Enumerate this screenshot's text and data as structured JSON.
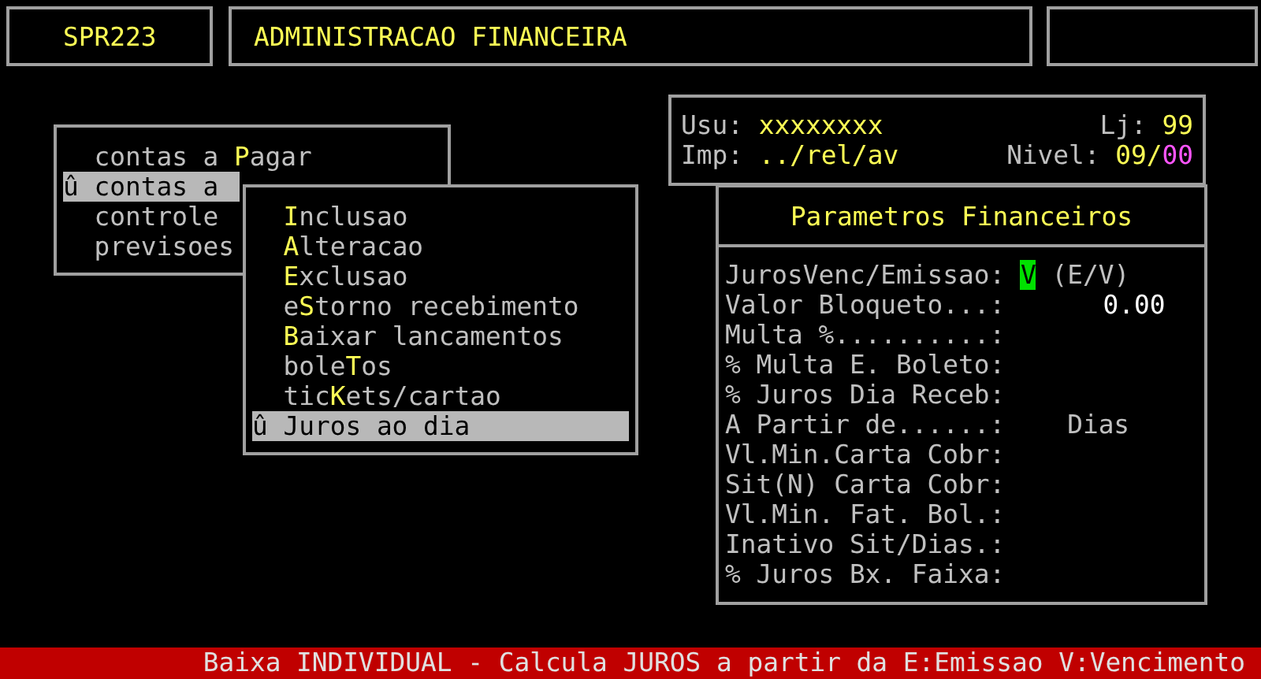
{
  "header": {
    "program_code": "SPR223",
    "title": "ADMINISTRACAO FINANCEIRA"
  },
  "main_menu": {
    "items": [
      {
        "label": "contas a ",
        "key": "P",
        "rest": "agar",
        "selected": false
      },
      {
        "marker": "û",
        "label": "contas a",
        "selected": true
      },
      {
        "label": "controle",
        "selected": false
      },
      {
        "label": "previsoes",
        "selected": false
      }
    ]
  },
  "user_info": {
    "user_label": "Usu:",
    "user": "xxxxxxxx",
    "store_label": "Lj:",
    "store": "99",
    "printer_label": "Imp:",
    "printer": "../rel/av",
    "level_label": "Nivel:",
    "level_value": "09",
    "level_separator": "/",
    "sub_level": "00"
  },
  "submenu": {
    "items": [
      {
        "key": "I",
        "rest": "nclusao",
        "selected": false
      },
      {
        "key": "A",
        "rest": "lteracao",
        "selected": false
      },
      {
        "key": "E",
        "rest": "xclusao",
        "selected": false
      },
      {
        "label": "e",
        "key": "S",
        "rest": "torno recebimento",
        "selected": false
      },
      {
        "key": "B",
        "rest": "aixar lancamentos",
        "selected": false
      },
      {
        "label": "bole",
        "key": "T",
        "rest": "os",
        "selected": false
      },
      {
        "label": "tic",
        "key": "K",
        "rest": "ets/cartao",
        "selected": false
      },
      {
        "marker": "û",
        "label": "Juros ao dia",
        "selected": true
      }
    ]
  },
  "parameters": {
    "title": "Parametros Financeiros",
    "fields": [
      {
        "kind": "choice",
        "label": "JurosVenc/Emissao:",
        "value": "V",
        "hint": "(E/V)"
      },
      {
        "kind": "amount",
        "label": "Valor Bloqueto...:",
        "value": "0.00"
      },
      {
        "kind": "blank",
        "label": "Multa %..........:"
      },
      {
        "kind": "blank",
        "label": "% Multa E. Boleto:"
      },
      {
        "kind": "blank",
        "label": "% Juros Dia Receb:"
      },
      {
        "kind": "unit",
        "label": "A Partir de......:",
        "hint": "Dias"
      },
      {
        "kind": "blank",
        "label": "Vl.Min.Carta Cobr:"
      },
      {
        "kind": "blank",
        "label": "Sit(N) Carta Cobr:"
      },
      {
        "kind": "blank",
        "label": "Vl.Min. Fat. Bol.:"
      },
      {
        "kind": "blank",
        "label": "Inativo Sit/Dias.:"
      },
      {
        "kind": "blank",
        "label": "% Juros Bx. Faixa:"
      }
    ]
  },
  "status_bar": "Baixa INDIVIDUAL - Calcula JUROS a partir da E:Emissao V:Vencimento"
}
